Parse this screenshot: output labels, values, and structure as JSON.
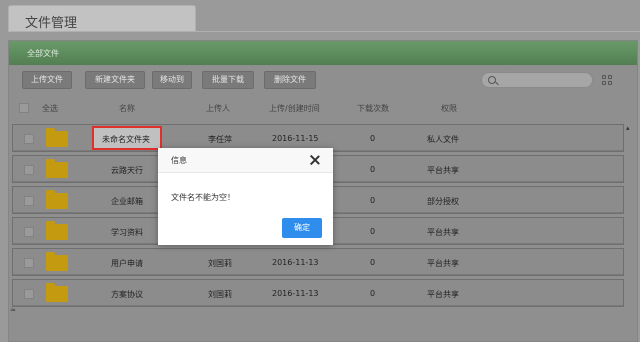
{
  "page": {
    "title": "文件管理"
  },
  "panel": {
    "title": "全部文件"
  },
  "toolbar": {
    "buttons": [
      "上传文件",
      "新建文件夹",
      "移动到",
      "批量下载",
      "删除文件"
    ],
    "search_placeholder": ""
  },
  "table": {
    "headers": {
      "select_all": "全选",
      "name": "名称",
      "uploader": "上传人",
      "time": "上传/创建时间",
      "downloads": "下载次数",
      "permission": "权限"
    },
    "rows": [
      {
        "name": "未命名文件夹",
        "uploader": "李任萍",
        "time": "2016-11-15",
        "downloads": "0",
        "permission": "私人文件"
      },
      {
        "name": "云路天行",
        "uploader": "",
        "time": "",
        "downloads": "0",
        "permission": "平台共享"
      },
      {
        "name": "企业邮箱",
        "uploader": "",
        "time": "",
        "downloads": "0",
        "permission": "部分授权"
      },
      {
        "name": "学习资料",
        "uploader": "",
        "time": "",
        "downloads": "0",
        "permission": "平台共享"
      },
      {
        "name": "用户申请",
        "uploader": "刘国莉",
        "time": "2016-11-13",
        "downloads": "0",
        "permission": "平台共享"
      },
      {
        "name": "方案协议",
        "uploader": "刘国莉",
        "time": "2016-11-13",
        "downloads": "0",
        "permission": "平台共享"
      }
    ]
  },
  "modal": {
    "title": "信息",
    "message": "文件名不能为空！",
    "ok_label": "确定"
  },
  "icons": {
    "folder": "folder-icon",
    "search": "search-icon",
    "grid": "grid-view-icon",
    "close": "close-icon"
  },
  "colors": {
    "header_green": "#5e8e5e",
    "folder": "#c49a10",
    "ok_button": "#2e8ded",
    "highlight_border": "#e0302b"
  }
}
